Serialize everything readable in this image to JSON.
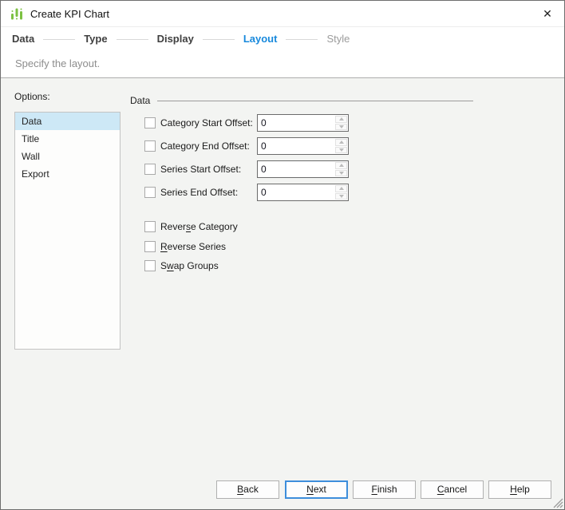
{
  "window": {
    "title": "Create KPI Chart",
    "close_glyph": "✕"
  },
  "wizard": {
    "steps": [
      {
        "label": "Data",
        "state": "completed"
      },
      {
        "label": "Type",
        "state": "completed"
      },
      {
        "label": "Display",
        "state": "completed"
      },
      {
        "label": "Layout",
        "state": "active"
      },
      {
        "label": "Style",
        "state": "upcoming"
      }
    ]
  },
  "header": {
    "subtitle": "Specify the layout."
  },
  "options_panel": {
    "label": "Options:",
    "items": [
      {
        "label": "Data",
        "selected": true
      },
      {
        "label": "Title",
        "selected": false
      },
      {
        "label": "Wall",
        "selected": false
      },
      {
        "label": "Export",
        "selected": false
      }
    ]
  },
  "main": {
    "group_title": "Data",
    "offset_rows": [
      {
        "label": "Category Start Offset:",
        "value": "0",
        "checked": false,
        "spinner_enabled": false
      },
      {
        "label": "Category End Offset:",
        "value": "0",
        "checked": false,
        "spinner_enabled": false
      },
      {
        "label": "Series Start Offset:",
        "value": "0",
        "checked": false,
        "spinner_enabled": false
      },
      {
        "label": "Series End Offset:",
        "value": "0",
        "checked": false,
        "spinner_enabled": false
      }
    ],
    "flags": [
      {
        "pre": "Rever",
        "key": "s",
        "post": "e Category",
        "checked": false
      },
      {
        "pre": "",
        "key": "R",
        "post": "everse Series",
        "checked": false
      },
      {
        "pre": "S",
        "key": "w",
        "post": "ap Groups",
        "checked": false
      }
    ]
  },
  "footer": {
    "buttons": [
      {
        "pre": "",
        "key": "B",
        "post": "ack",
        "focused": false
      },
      {
        "pre": "",
        "key": "N",
        "post": "ext",
        "focused": true
      },
      {
        "pre": "",
        "key": "F",
        "post": "inish",
        "focused": false
      },
      {
        "pre": "",
        "key": "C",
        "post": "ancel",
        "focused": false
      },
      {
        "pre": "",
        "key": "H",
        "post": "elp",
        "focused": false
      }
    ]
  },
  "icons": {
    "app": "kpi-chart-icon",
    "close": "close-icon",
    "spinner_up": "spinner-up-arrow-icon",
    "spinner_down": "spinner-down-arrow-icon",
    "resize": "resize-grip-icon"
  },
  "colors": {
    "accent_blue": "#1889dc",
    "step_text": "#3f3f3f",
    "selection_blue": "#cde8f6",
    "icon_green": "#7cc142",
    "focus_border": "#3d8edb",
    "body_bg": "#f3f4f2"
  }
}
